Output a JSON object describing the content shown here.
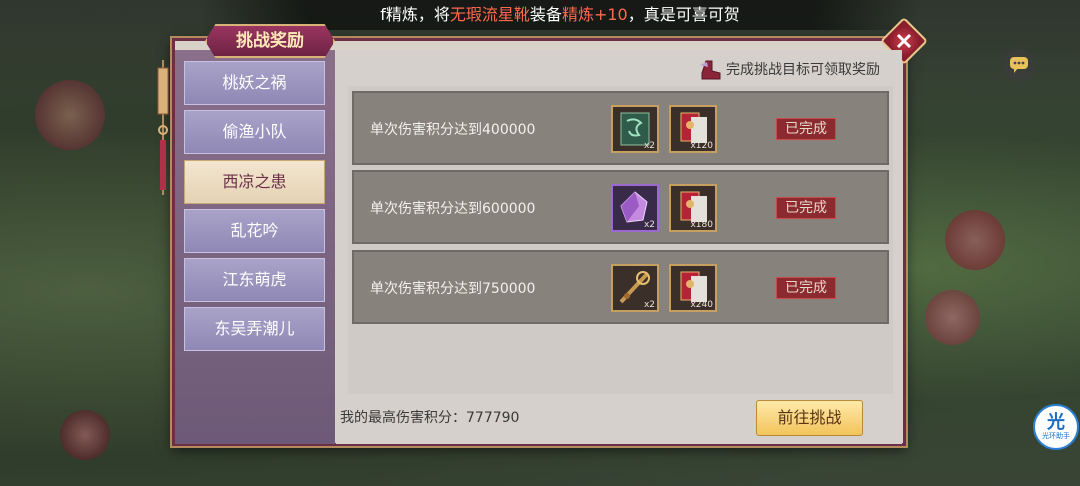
{
  "banner": {
    "prefix": "f精炼，将",
    "item": "无瑕流星靴",
    "middle": "装备",
    "refine": "精炼+10",
    "suffix": "，真是可喜可贺"
  },
  "panel": {
    "title": "挑战奖励",
    "hint": "完成挑战目标可领取奖励"
  },
  "sidebar": {
    "items": [
      {
        "label": "桃妖之祸",
        "active": false
      },
      {
        "label": "偷渔小队",
        "active": false
      },
      {
        "label": "西凉之患",
        "active": true
      },
      {
        "label": "乱花吟",
        "active": false
      },
      {
        "label": "江东萌虎",
        "active": false
      },
      {
        "label": "东吴弄潮儿",
        "active": false
      }
    ]
  },
  "challenges": [
    {
      "label": "单次伤害积分达到400000",
      "rewards": [
        {
          "icon": "green-dragon-book-icon",
          "count": "x2"
        },
        {
          "icon": "red-scroll-icon",
          "count": "x120"
        }
      ],
      "status": "已完成"
    },
    {
      "label": "单次伤害积分达到600000",
      "rewards": [
        {
          "icon": "purple-crystal-icon",
          "count": "x2"
        },
        {
          "icon": "red-scroll-icon",
          "count": "x180"
        }
      ],
      "status": "已完成"
    },
    {
      "label": "单次伤害积分达到750000",
      "rewards": [
        {
          "icon": "bronze-weapon-icon",
          "count": "x2"
        },
        {
          "icon": "red-scroll-icon",
          "count": "x240"
        }
      ],
      "status": "已完成"
    }
  ],
  "footer": {
    "score_label": "我的最高伤害积分：",
    "score_value": "777790",
    "go_button": "前往挑战"
  },
  "assist": {
    "big": "光",
    "small": "光环助手"
  },
  "colors": {
    "frame": "#6b3048",
    "done": "#8b2a2f",
    "button": "#f2c45c"
  }
}
